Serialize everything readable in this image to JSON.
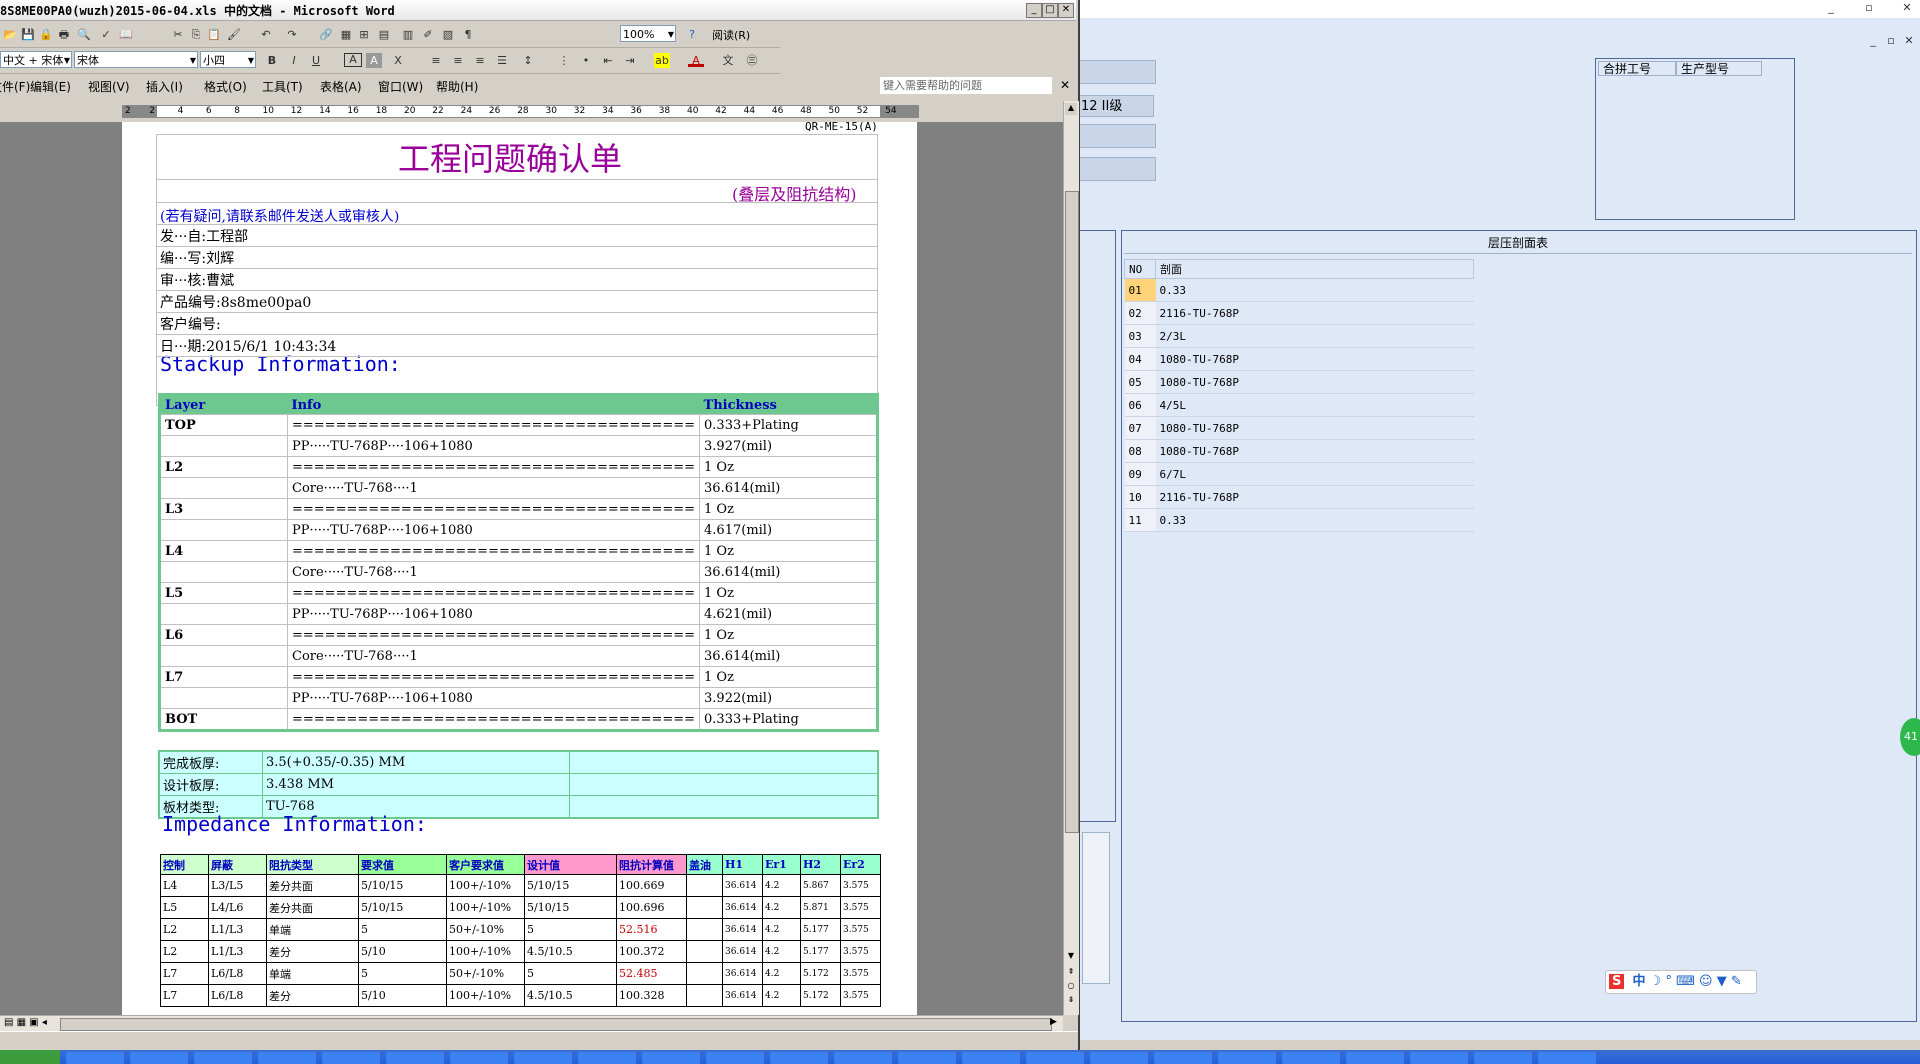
{
  "word": {
    "title": "8S8ME00PA0(wuzh)2015-06-04.xls 中的文档 - Microsoft Word",
    "toolbar_icons": [
      "open-icon",
      "save-icon",
      "permission-icon",
      "print-icon",
      "print-preview-icon",
      "spelling-icon",
      "research-icon",
      "cut-icon",
      "copy-icon",
      "paste-icon",
      "format-painter-icon",
      "undo-icon",
      "redo-icon",
      "hyperlink-icon",
      "tables-borders-icon",
      "insert-table-icon",
      "insert-excel-icon",
      "columns-icon",
      "drawing-icon",
      "document-map-icon",
      "show-hide-icon",
      "help-icon",
      "read-icon"
    ],
    "font_script": "中文 + 宋体",
    "font_name": "宋体",
    "font_size": "小四",
    "zoom": "100%",
    "read_label": "阅读(R)",
    "menus": [
      "文件(F)",
      "编辑(E)",
      "视图(V)",
      "插入(I)",
      "格式(O)",
      "工具(T)",
      "表格(A)",
      "窗口(W)",
      "帮助(H)"
    ],
    "help_placeholder": "键入需要帮助的问题",
    "ruler_numbers": [
      "2",
      "2",
      "4",
      "6",
      "8",
      "10",
      "12",
      "14",
      "16",
      "18",
      "20",
      "22",
      "24",
      "26",
      "28",
      "30",
      "32",
      "34",
      "36",
      "38",
      "40",
      "42",
      "44",
      "46",
      "48",
      "50",
      "52",
      "54"
    ]
  },
  "doc": {
    "doc_code": "QR-ME-15(A)",
    "main_title": "工程问题确认单",
    "subtitle": "(叠层及阻抗结构)",
    "note": "(若有疑问,请联系邮件发送人或审核人)",
    "fields": [
      {
        "label": "发···自:",
        "value": "工程部"
      },
      {
        "label": "编···写:",
        "value": "刘辉"
      },
      {
        "label": "审···核:",
        "value": "曹斌"
      },
      {
        "label": "产品编号:",
        "value": "8s8me00pa0"
      },
      {
        "label": "客户编号:",
        "value": ""
      },
      {
        "label": "日···期:",
        "value": "2015/6/1 10:43:34"
      }
    ],
    "stackup_heading": "Stackup Information:",
    "stack_headers": [
      "Layer",
      "Info",
      "Thickness"
    ],
    "stack_rows": [
      [
        "TOP",
        "=====================================",
        "0.333+Plating"
      ],
      [
        "",
        "PP·····TU-768P····106+1080",
        "3.927(mil)"
      ],
      [
        "L2",
        "=====================================",
        "1 Oz"
      ],
      [
        "",
        "Core·····TU-768····1",
        "36.614(mil)"
      ],
      [
        "L3",
        "=====================================",
        "1 Oz"
      ],
      [
        "",
        "PP·····TU-768P····106+1080",
        "4.617(mil)"
      ],
      [
        "L4",
        "=====================================",
        "1 Oz"
      ],
      [
        "",
        "Core·····TU-768····1",
        "36.614(mil)"
      ],
      [
        "L5",
        "=====================================",
        "1 Oz"
      ],
      [
        "",
        "PP·····TU-768P····106+1080",
        "4.621(mil)"
      ],
      [
        "L6",
        "=====================================",
        "1 Oz"
      ],
      [
        "",
        "Core·····TU-768····1",
        "36.614(mil)"
      ],
      [
        "L7",
        "=====================================",
        "1 Oz"
      ],
      [
        "",
        "PP·····TU-768P····106+1080",
        "3.922(mil)"
      ],
      [
        "BOT",
        "=====================================",
        "0.333+Plating"
      ]
    ],
    "thickness_rows": [
      {
        "label": "完成板厚:",
        "value": "3.5(+0.35/-0.35) MM"
      },
      {
        "label": "设计板厚:",
        "value": "3.438 MM"
      },
      {
        "label": "板材类型:",
        "value": "TU-768"
      }
    ],
    "impedance_heading": "Impedance Information:",
    "imp_headers": [
      "控制",
      "屏蔽",
      "阻抗类型",
      "要求值",
      "客户要求值",
      "设计值",
      "阻抗计算值",
      "盖油",
      "H1",
      "Er1",
      "H2",
      "Er2"
    ],
    "imp_rows": [
      [
        "L4",
        "L3/L5",
        "差分共面",
        "5/10/15",
        "100+/-10%",
        "5/10/15",
        "100.669",
        "",
        "36.614",
        "4.2",
        "5.867",
        "3.575"
      ],
      [
        "L5",
        "L4/L6",
        "差分共面",
        "5/10/15",
        "100+/-10%",
        "5/10/15",
        "100.696",
        "",
        "36.614",
        "4.2",
        "5.871",
        "3.575"
      ],
      [
        "L2",
        "L1/L3",
        "单端",
        "5",
        "50+/-10%",
        "5",
        "52.516",
        "",
        "36.614",
        "4.2",
        "5.177",
        "3.575"
      ],
      [
        "L2",
        "L1/L3",
        "差分",
        "5/10",
        "100+/-10%",
        "4.5/10.5",
        "100.372",
        "",
        "36.614",
        "4.2",
        "5.177",
        "3.575"
      ],
      [
        "L7",
        "L6/L8",
        "单端",
        "5",
        "50+/-10%",
        "5",
        "52.485",
        "",
        "36.614",
        "4.2",
        "5.172",
        "3.575"
      ],
      [
        "L7",
        "L6/L8",
        "差分",
        "5/10",
        "100+/-10%",
        "4.5/10.5",
        "100.328",
        "",
        "36.614",
        "4.2",
        "5.172",
        "3.575"
      ]
    ]
  },
  "bg_app": {
    "level_label": "12 II级",
    "panel_headers": [
      "合拼工号",
      "生产型号"
    ],
    "section_title": "层压剖面表",
    "table_headers": [
      "NO",
      "剖面"
    ],
    "rows": [
      [
        "01",
        "0.33"
      ],
      [
        "02",
        "2116-TU-768P"
      ],
      [
        "03",
        "2/3L"
      ],
      [
        "04",
        "1080-TU-768P"
      ],
      [
        "05",
        "1080-TU-768P"
      ],
      [
        "06",
        "4/5L"
      ],
      [
        "07",
        "1080-TU-768P"
      ],
      [
        "08",
        "1080-TU-768P"
      ],
      [
        "09",
        "6/7L"
      ],
      [
        "10",
        "2116-TU-768P"
      ],
      [
        "11",
        "0.33"
      ]
    ],
    "ime_label": "中",
    "circle_label": "41"
  },
  "colors": {
    "title_purple": "#990099",
    "heading_blue": "#0000cc",
    "stack_green": "#6dc88f",
    "thickness_cyan": "#ccffff",
    "red_value": "#cc0000"
  }
}
